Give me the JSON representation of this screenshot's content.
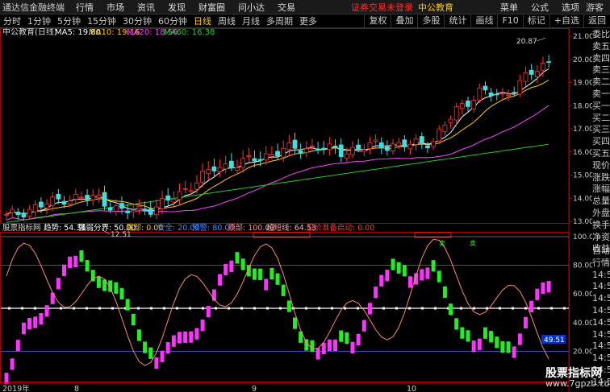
{
  "menubar": {
    "app_title": "通达信金融终端",
    "items": [
      "行情",
      "市场",
      "资讯",
      "发现",
      "财富圈",
      "问小达",
      "交易"
    ],
    "notice": "证券交易未登录",
    "stock_name": "中公教育",
    "right_items": [
      "菜单",
      "公式",
      "选项"
    ],
    "guest": "游客"
  },
  "periodbar": {
    "periods": [
      "分时",
      "1分钟",
      "5分钟",
      "15分钟",
      "30分钟",
      "60分钟",
      "日线",
      "周线",
      "月线",
      "多周期",
      "更多"
    ],
    "active": "日线",
    "tools": [
      "复权",
      "叠加",
      "多股",
      "统计",
      "画线",
      "F10",
      "标记",
      "+自选",
      "返回"
    ]
  },
  "main_chart": {
    "title": "中公教育(日线)",
    "ma5_label": "MA5: 19.80",
    "ma10_label": "MA10: 19.16",
    "ma20_label": "MA20: 18.56",
    "ma60_label": "MA60: 16.38",
    "high_label": "20.87",
    "low_label": "12.51",
    "ticks": [
      "21.00",
      "20.00",
      "19.00",
      "18.00",
      "17.00",
      "16.00",
      "15.00",
      "14.00",
      "13.00"
    ],
    "colors": {
      "ma5": "#ffffff",
      "ma10": "#ffcc00",
      "ma20": "#ff44ff",
      "ma60": "#22cc22",
      "up": "#ff3333",
      "down": "#44dddd"
    }
  },
  "indicator": {
    "name": "股票指标网",
    "trend_label": "趋势: 54.36",
    "strong_weak_label": "强弱分界: 50.00",
    "bottom_label": "底部: 0.00",
    "safe_label": "安全: 20.00",
    "warn_label": "预警: 80.00",
    "top_label": "顶部: 100.00",
    "overbuy_label": "超短线: 64.53",
    "signal_label": "股价准备启动: 0.00",
    "ticks": [
      "100.00",
      "80.00",
      "60.00",
      "40.00",
      "20.00"
    ],
    "value_badge": "49.51",
    "sell_labels": [
      "卖",
      "卖"
    ]
  },
  "dates": [
    "2019年",
    "8",
    "9",
    "10"
  ],
  "side_panel": [
    "委比",
    "卖五",
    "卖四",
    "卖三",
    "卖二",
    "卖一",
    "买一",
    "买二",
    "买三",
    "买四",
    "买五",
    "现价",
    "涨跌",
    "涨幅",
    "总量",
    "外盘",
    "换手",
    "净资",
    "收益"
  ],
  "side_panel2": [
    "自动",
    "行情",
    "14:5",
    "14:5",
    "14:5",
    "14:5",
    "14:5",
    "14:5",
    "14:5",
    "14:5",
    "14:5",
    "14:5"
  ],
  "watermark": {
    "title": "股票指标网",
    "url": "www.7gpzb.com"
  }
}
